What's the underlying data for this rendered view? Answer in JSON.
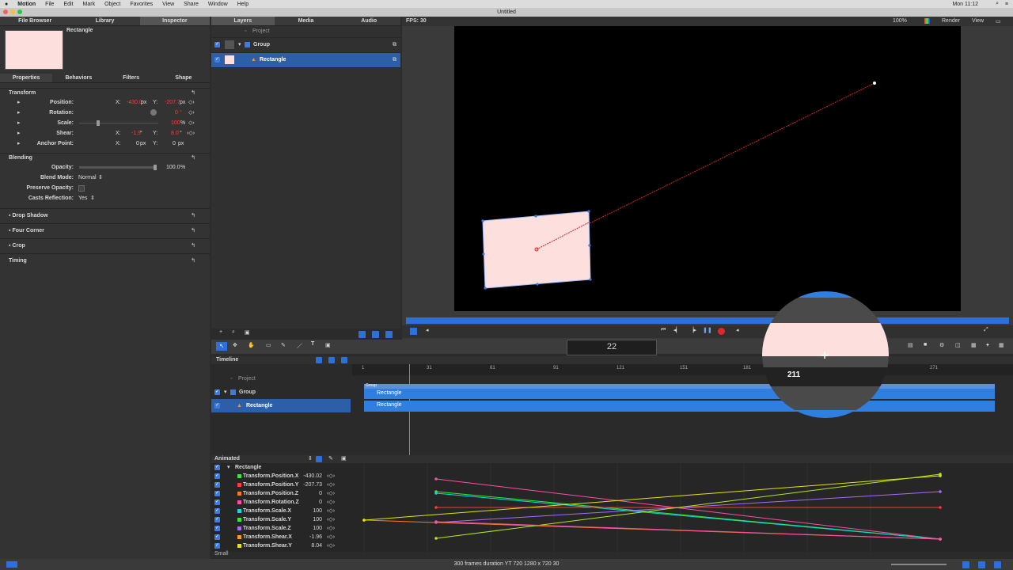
{
  "menubar": {
    "app": "Motion",
    "items": [
      "File",
      "Edit",
      "Mark",
      "Object",
      "Favorites",
      "View",
      "Share",
      "Window",
      "Help"
    ],
    "clock": "Mon 11:12"
  },
  "window": {
    "title": "Untitled"
  },
  "inspector": {
    "tabs": [
      "File Browser",
      "Library",
      "Inspector"
    ],
    "selected_name": "Rectangle",
    "subtabs": [
      "Properties",
      "Behaviors",
      "Filters",
      "Shape"
    ],
    "transform": {
      "title": "Transform",
      "rows": [
        {
          "label": "Position:",
          "x": "-430.0",
          "xunit": "px",
          "y": "-207.7",
          "yunit": "px"
        },
        {
          "label": "Rotation:",
          "v": "0",
          "unit": "°"
        },
        {
          "label": "Scale:",
          "v": "100",
          "unit": "%"
        },
        {
          "label": "Shear:",
          "x": "-1.9",
          "xunit": "°",
          "y": "8.0",
          "yunit": "°"
        },
        {
          "label": "Anchor Point:",
          "x": "0",
          "xunit": "px",
          "y": "0",
          "yunit": "px"
        }
      ]
    },
    "blending": {
      "title": "Blending",
      "opacity_label": "Opacity:",
      "opacity": "100.0",
      "opacity_unit": "%",
      "blend_label": "Blend Mode:",
      "blend": "Normal",
      "preserve_label": "Preserve Opacity:",
      "casts_label": "Casts Reflection:",
      "casts": "Yes"
    },
    "sections": [
      "Drop Shadow",
      "Four Corner",
      "Crop",
      "Timing"
    ]
  },
  "layers": {
    "tabs": [
      "Layers",
      "Media",
      "Audio"
    ],
    "project": "Project",
    "group": "Group",
    "rectangle": "Rectangle"
  },
  "canvas": {
    "fps": "FPS: 30",
    "zoom": "100%",
    "render": "Render",
    "view": "View"
  },
  "toolbar": {
    "timecode": "22"
  },
  "timeline": {
    "title": "Timeline",
    "project": "Project",
    "group": "Group",
    "rectangle": "Rectangle",
    "ruler": [
      "1",
      "31",
      "61",
      "91",
      "121",
      "151",
      "181",
      "211",
      "271"
    ],
    "bar_group": "Group",
    "bar_rect": "Rectangle",
    "bar_rect2": "Rectangle",
    "magnifier": "211"
  },
  "animated": {
    "title": "Animated",
    "object": "Rectangle",
    "rows": [
      {
        "label": "Transform.Position.X",
        "value": "-430.02",
        "color": "#39e639"
      },
      {
        "label": "Transform.Position.Y",
        "value": "-207.73",
        "color": "#ff3b3b"
      },
      {
        "label": "Transform.Position.Z",
        "value": "0",
        "color": "#ff7a1a"
      },
      {
        "label": "Transform.Rotation.Z",
        "value": "0",
        "color": "#ff4da6"
      },
      {
        "label": "Transform.Scale.X",
        "value": "100",
        "color": "#00e0e0"
      },
      {
        "label": "Transform.Scale.Y",
        "value": "100",
        "color": "#39e639"
      },
      {
        "label": "Transform.Scale.Z",
        "value": "100",
        "color": "#a86bff"
      },
      {
        "label": "Transform.Shear.X",
        "value": "-1.96",
        "color": "#ff9a1a"
      },
      {
        "label": "Transform.Shear.Y",
        "value": "8.04",
        "color": "#e6e600"
      }
    ],
    "size": "Small"
  },
  "status": {
    "text": "300 frames duration YT 720 1280 x 720 30"
  },
  "colors": {
    "accent": "#3d7be0",
    "selection": "#2d5fa8",
    "clip": "#2f7fe0"
  }
}
